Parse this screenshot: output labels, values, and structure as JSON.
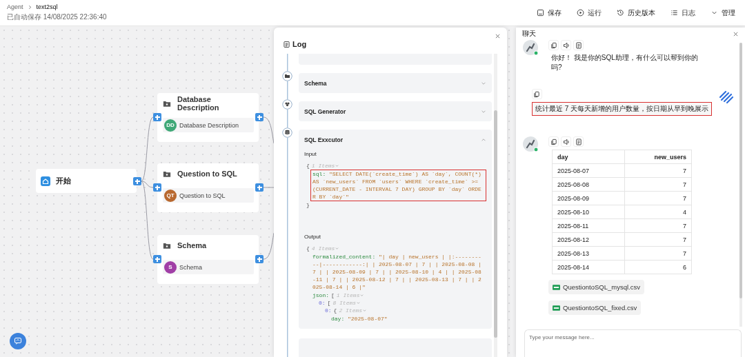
{
  "header": {
    "breadcrumb": [
      "Agent",
      "text2sql"
    ],
    "autosave": "已自动保存 14/08/2025 22:36:40",
    "actions": [
      {
        "kind": "save",
        "label": "保存"
      },
      {
        "kind": "run",
        "label": "运行"
      },
      {
        "kind": "history",
        "label": "历史版本"
      },
      {
        "kind": "log",
        "label": "日志"
      },
      {
        "kind": "manage",
        "label": "管理"
      }
    ]
  },
  "canvas": {
    "start": {
      "label": "开始"
    },
    "nodes": [
      {
        "title": "Database Description",
        "badge": "DD",
        "color": "#3fa877",
        "component": "Database Description"
      },
      {
        "title": "Question to SQL",
        "badge": "QT",
        "color": "#b8682f",
        "component": "Question to SQL"
      },
      {
        "title": "Schema",
        "badge": "S",
        "color": "#a03ea6",
        "component": "Schema"
      }
    ]
  },
  "log": {
    "title": "Log",
    "steps": [
      {
        "kind": "folder",
        "title": "Schema",
        "expanded": false
      },
      {
        "kind": "cube",
        "title": "SQL Generator",
        "expanded": false
      },
      {
        "kind": "database",
        "title": "SQL Exxcutor",
        "expanded": true,
        "input_label": "Input",
        "input": {
          "open": "{",
          "meta": "1 Items",
          "close": "}",
          "entries": [
            {
              "kind": "field",
              "key": "sql:",
              "value": "\"SELECT DATE(`create_time`) AS `day`, COUNT(*) AS `new_users` FROM `users` WHERE `create_time` >= (CURRENT_DATE - INTERVAL 7 DAY) GROUP BY `day` ORDER BY `day`\"",
              "highlighted": true
            }
          ]
        },
        "output_label": "Output",
        "output": {
          "open": "{",
          "meta": "4 Items",
          "entries": [
            {
              "kind": "field",
              "key": "formalized_content:",
              "value": "\"| day | new_users | |:----------|------------:| | 2025-08-07 | 7 | | 2025-08-08 | 7 | | 2025-08-09 | 7 | | 2025-08-10 | 4 | | 2025-08-11 | 7 | | 2025-08-12 | 7 | | 2025-08-13 | 7 | | 2025-08-14 | 6 |\"",
              "highlighted": false
            },
            {
              "kind": "field",
              "key": "json:",
              "open": "[",
              "meta": "1 Items",
              "entries": [
                {
                  "kind": "index",
                  "key": "0:",
                  "open": "[",
                  "meta": "8 Items",
                  "entries": [
                    {
                      "kind": "index",
                      "key": "0:",
                      "open": "{",
                      "meta": "2 Items",
                      "entries": [
                        {
                          "kind": "field",
                          "key": "day:",
                          "value": "\"2025-08-07\"",
                          "highlighted": false
                        }
                      ]
                    }
                  ]
                }
              ]
            }
          ]
        }
      }
    ]
  },
  "chat": {
    "title": "聊天",
    "messages": [
      {
        "kind": "bot",
        "actions": [
          {
            "kind": "copy"
          },
          {
            "kind": "speak"
          },
          {
            "kind": "doc"
          }
        ],
        "text": "你好！ 我是你的SQL助理，有什么可以帮到你的吗?"
      },
      {
        "kind": "user",
        "actions": [
          {
            "kind": "copy"
          }
        ],
        "text": "统计最近 7 天每天新增的用户数量，按日期从早到晚展示",
        "highlighted": true
      },
      {
        "kind": "bot",
        "actions": [
          {
            "kind": "copy"
          },
          {
            "kind": "speak"
          },
          {
            "kind": "doc"
          }
        ],
        "table": {
          "columns": [
            "day",
            "new_users"
          ],
          "rows": [
            [
              "2025-08-07",
              "7"
            ],
            [
              "2025-08-08",
              "7"
            ],
            [
              "2025-08-09",
              "7"
            ],
            [
              "2025-08-10",
              "4"
            ],
            [
              "2025-08-11",
              "7"
            ],
            [
              "2025-08-12",
              "7"
            ],
            [
              "2025-08-13",
              "7"
            ],
            [
              "2025-08-14",
              "6"
            ]
          ]
        },
        "files": [
          "QuestiontoSQL_mysql.csv",
          "QuestiontoSQL_fixed.csv"
        ]
      }
    ],
    "input": {
      "placeholder": "Type your message here..."
    }
  }
}
